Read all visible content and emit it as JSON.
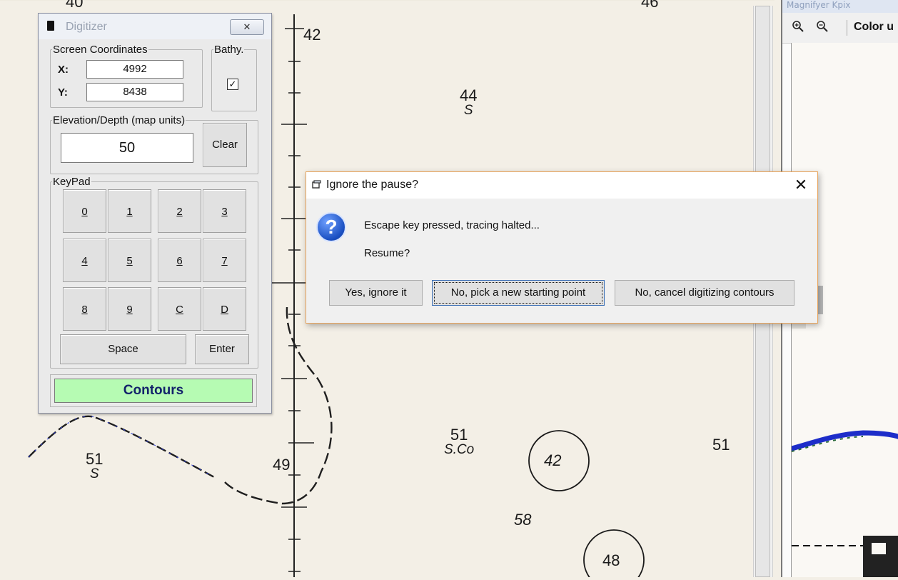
{
  "map": {
    "soundings": [
      {
        "id": "sounding-40",
        "text": "40"
      },
      {
        "id": "sounding-42-top",
        "text": "42"
      },
      {
        "id": "sounding-46",
        "text": "46"
      },
      {
        "id": "sounding-44",
        "text": "44",
        "sub": "S"
      },
      {
        "id": "sounding-51-left",
        "text": "51",
        "sub": "S"
      },
      {
        "id": "sounding-49",
        "text": "49"
      },
      {
        "id": "sounding-51-center",
        "text": "51",
        "sub": "S.Co"
      },
      {
        "id": "sounding-42-circle",
        "text": "42"
      },
      {
        "id": "sounding-51-right",
        "text": "51"
      },
      {
        "id": "sounding-58",
        "text": "58"
      },
      {
        "id": "sounding-48-circle",
        "text": "48"
      }
    ]
  },
  "magnifier": {
    "title": "Magnifyer Kpix",
    "zoom_in_icon": "zoom-in-icon",
    "zoom_out_icon": "zoom-out-icon",
    "color_label": "Color u"
  },
  "digitizer": {
    "title": "Digitizer",
    "close_glyph": "✕",
    "screen_coords_label": "Screen Coordinates",
    "x_label": "X:",
    "x_value": "4992",
    "y_label": "Y:",
    "y_value": "8438",
    "bathy_label": "Bathy.",
    "bathy_checked": "✓",
    "elevation_label": "Elevation/Depth (map units)",
    "elevation_value": "50",
    "clear_label": "Clear",
    "keypad_label": "KeyPad",
    "keys": [
      "0",
      "1",
      "2",
      "3",
      "4",
      "5",
      "6",
      "7",
      "8",
      "9",
      "C",
      "D"
    ],
    "space_label": "Space",
    "enter_label": "Enter",
    "mode_label": "Contours",
    "mode_color": "#b6fbb3"
  },
  "dialog": {
    "title": "Ignore the pause?",
    "close_glyph": "✕",
    "message": "Escape key pressed, tracing halted...",
    "question": "Resume?",
    "buttons": {
      "yes": "Yes, ignore it",
      "no_pick": "No, pick a new starting point",
      "no_cancel": "No, cancel digitizing contours"
    },
    "border_color": "#e8a35a"
  }
}
